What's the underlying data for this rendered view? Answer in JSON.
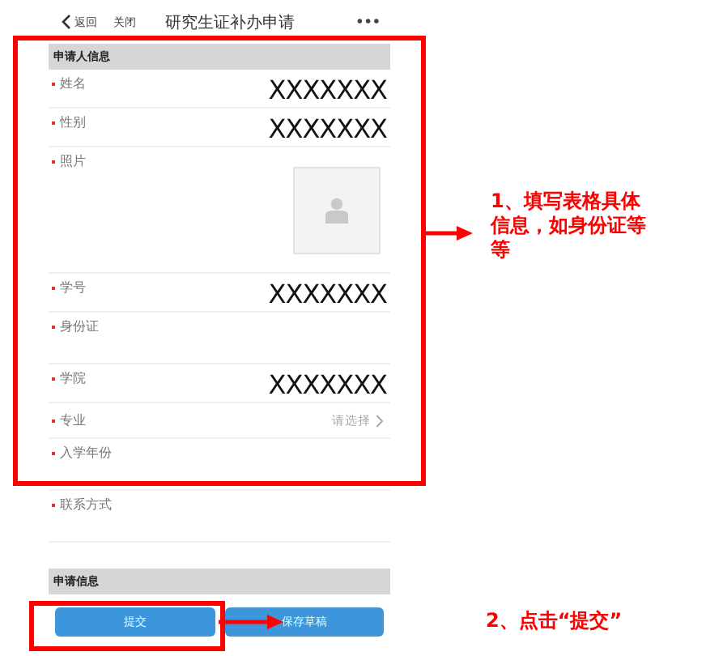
{
  "nav": {
    "back": "返回",
    "close": "关闭",
    "title": "研究生证补办申请",
    "more": "•••"
  },
  "sections": [
    {
      "title": "申请人信息",
      "fields": [
        {
          "kind": "text",
          "label": "姓名",
          "required": true,
          "value": "XXXXXXX"
        },
        {
          "kind": "text",
          "label": "性别",
          "required": true,
          "value": "XXXXXXX"
        },
        {
          "kind": "photo",
          "label": "照片",
          "required": true
        },
        {
          "kind": "text",
          "label": "学号",
          "required": true,
          "value": "XXXXXXX"
        },
        {
          "kind": "text",
          "label": "身份证",
          "required": true
        },
        {
          "kind": "text",
          "label": "学院",
          "required": true,
          "value": "XXXXXXX"
        },
        {
          "kind": "select",
          "label": "专业",
          "required": true,
          "placeholder": "请选择"
        },
        {
          "kind": "text",
          "label": "入学年份",
          "required": true
        },
        {
          "kind": "text",
          "label": "联系方式",
          "required": true
        }
      ]
    },
    {
      "title": "申请信息"
    }
  ],
  "buttons": [
    {
      "label": "提交"
    },
    {
      "label": "保存草稿"
    }
  ],
  "annotations": [
    {
      "text": "1、填写表格具体信息，如身份证等等"
    },
    {
      "text": "2、点击“提交”"
    }
  ]
}
